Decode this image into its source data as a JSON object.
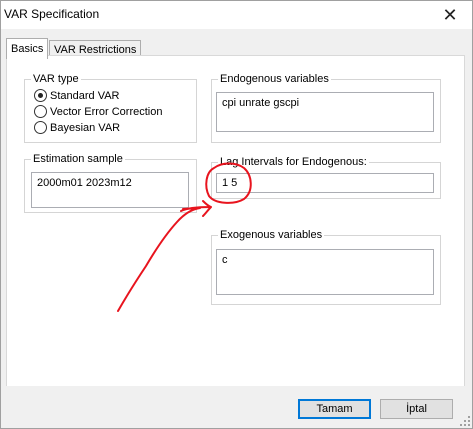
{
  "window": {
    "title": "VAR Specification"
  },
  "tabs": [
    {
      "label": "Basics",
      "active": true
    },
    {
      "label": "VAR Restrictions",
      "active": false
    }
  ],
  "var_type": {
    "label": "VAR type",
    "options": [
      {
        "label": "Standard VAR",
        "selected": true
      },
      {
        "label": "Vector Error Correction",
        "selected": false
      },
      {
        "label": "Bayesian VAR",
        "selected": false
      }
    ]
  },
  "endogenous": {
    "label": "Endogenous variables",
    "value": "cpi unrate gscpi"
  },
  "estimation_sample": {
    "label": "Estimation sample",
    "value": "2000m01 2023m12"
  },
  "lag_intervals": {
    "label": "Lag Intervals for Endogenous:",
    "value": "1 5"
  },
  "exogenous": {
    "label": "Exogenous variables",
    "value": "c"
  },
  "buttons": {
    "ok_label": "Tamam",
    "cancel_label": "İptal"
  },
  "colors": {
    "annotation": "#e8141e",
    "default_button_border": "#0078d7"
  },
  "icons": {
    "close": "close-icon",
    "resize": "resize-grip-icon"
  }
}
